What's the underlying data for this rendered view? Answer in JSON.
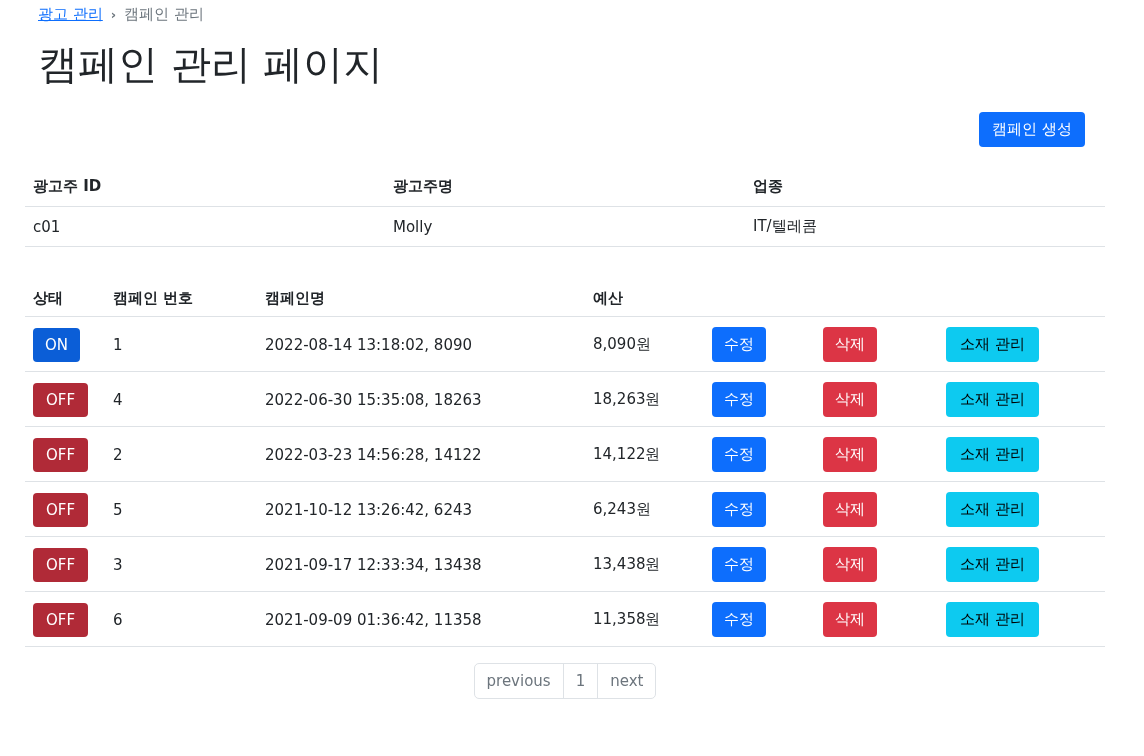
{
  "breadcrumb": [
    {
      "label": "광고 관리",
      "kind": "link"
    },
    {
      "label": "›",
      "kind": "separator"
    },
    {
      "label": "캠페인 관리",
      "kind": "current"
    }
  ],
  "title": "캠페인 관리 페이지",
  "create_button": "캠페인 생성",
  "advertiser_table": {
    "columns": [
      "광고주 ID",
      "광고주명",
      "업종"
    ],
    "rows": [
      [
        "c01",
        "Molly",
        "IT/텔레콤"
      ]
    ]
  },
  "campaign_table": {
    "columns": [
      "상태",
      "캠페인 번호",
      "캠페인명",
      "예산"
    ],
    "rows": [
      {
        "status": "ON",
        "on": true,
        "number": "1",
        "name": "2022-08-14 13:18:02, 8090",
        "budget": "8,090원",
        "edit": "수정",
        "delete": "삭제",
        "materials": "소재 관리"
      },
      {
        "status": "OFF",
        "on": false,
        "number": "4",
        "name": "2022-06-30 15:35:08, 18263",
        "budget": "18,263원",
        "edit": "수정",
        "delete": "삭제",
        "materials": "소재 관리"
      },
      {
        "status": "OFF",
        "on": false,
        "number": "2",
        "name": "2022-03-23 14:56:28, 14122",
        "budget": "14,122원",
        "edit": "수정",
        "delete": "삭제",
        "materials": "소재 관리"
      },
      {
        "status": "OFF",
        "on": false,
        "number": "5",
        "name": "2021-10-12 13:26:42, 6243",
        "budget": "6,243원",
        "edit": "수정",
        "delete": "삭제",
        "materials": "소재 관리"
      },
      {
        "status": "OFF",
        "on": false,
        "number": "3",
        "name": "2021-09-17 12:33:34, 13438",
        "budget": "13,438원",
        "edit": "수정",
        "delete": "삭제",
        "materials": "소재 관리"
      },
      {
        "status": "OFF",
        "on": false,
        "number": "6",
        "name": "2021-09-09 01:36:42, 11358",
        "budget": "11,358원",
        "edit": "수정",
        "delete": "삭제",
        "materials": "소재 관리"
      }
    ]
  },
  "pagination": [
    {
      "label": "previous",
      "selected": false
    },
    {
      "label": "1",
      "selected": false
    },
    {
      "label": "next",
      "selected": false
    }
  ]
}
